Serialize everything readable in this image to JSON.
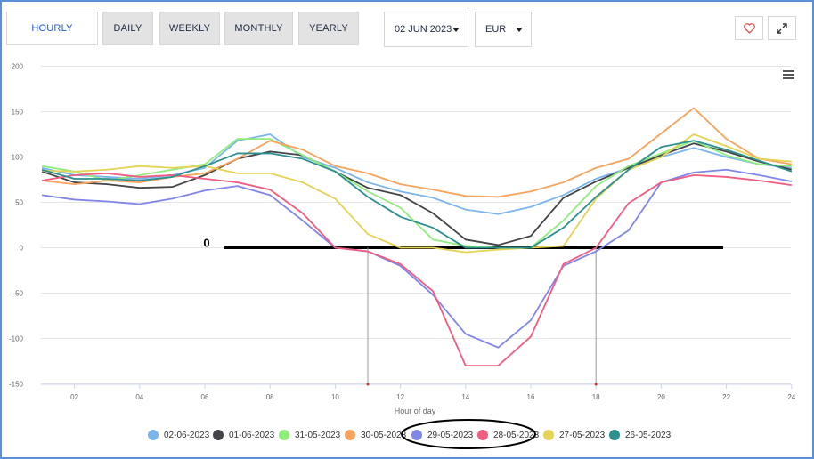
{
  "tabs": [
    {
      "label": "HOURLY",
      "active": true
    },
    {
      "label": "DAILY",
      "active": false
    },
    {
      "label": "WEEKLY",
      "active": false
    },
    {
      "label": "MONTHLY",
      "active": false
    },
    {
      "label": "YEARLY",
      "active": false
    }
  ],
  "date_select": {
    "value": "02 JUN 2023"
  },
  "currency_select": {
    "value": "EUR"
  },
  "icons": {
    "favorite": "heart-icon",
    "expand": "expand-icon",
    "menu": "hamburger-menu-icon"
  },
  "annotation": {
    "zero_label": "0"
  },
  "chart_data": {
    "type": "line",
    "xlabel": "Hour of day",
    "ylabel": "",
    "xlim": [
      0.5,
      24.2
    ],
    "ylim": [
      -150,
      200
    ],
    "y_ticks": [
      200,
      150,
      100,
      50,
      0,
      -50,
      -100,
      -150
    ],
    "x_ticks": [
      "02",
      "04",
      "06",
      "08",
      "10",
      "12",
      "14",
      "16",
      "18",
      "20",
      "22",
      "24"
    ],
    "grid": true,
    "legend_position": "bottom",
    "x": [
      1,
      2,
      3,
      4,
      5,
      6,
      7,
      8,
      9,
      10,
      11,
      12,
      13,
      14,
      15,
      16,
      17,
      18,
      19,
      20,
      21,
      22,
      23,
      24
    ],
    "series": [
      {
        "name": "02-06-2023",
        "color": "#7cb5ec",
        "values": [
          88,
          80,
          78,
          76,
          80,
          88,
          118,
          125,
          100,
          88,
          72,
          62,
          55,
          42,
          37,
          45,
          58,
          76,
          88,
          100,
          110,
          100,
          92,
          88
        ]
      },
      {
        "name": "01-06-2023",
        "color": "#434348",
        "values": [
          84,
          72,
          70,
          66,
          67,
          80,
          98,
          106,
          102,
          84,
          66,
          58,
          38,
          9,
          3,
          13,
          55,
          73,
          88,
          102,
          115,
          106,
          95,
          86
        ]
      },
      {
        "name": "31-05-2023",
        "color": "#90ed7d",
        "values": [
          90,
          84,
          74,
          80,
          86,
          92,
          120,
          120,
          102,
          84,
          62,
          44,
          9,
          2,
          0,
          0,
          30,
          68,
          90,
          104,
          118,
          102,
          92,
          90
        ]
      },
      {
        "name": "30-05-2023",
        "color": "#f7a35c",
        "values": [
          74,
          70,
          74,
          72,
          78,
          82,
          98,
          118,
          108,
          90,
          82,
          70,
          64,
          57,
          56,
          62,
          72,
          88,
          98,
          126,
          154,
          120,
          98,
          92
        ]
      },
      {
        "name": "29-05-2023",
        "color": "#8085e9",
        "values": [
          58,
          53,
          51,
          48,
          54,
          63,
          68,
          58,
          30,
          0,
          -4,
          -20,
          -52,
          -95,
          -110,
          -80,
          -20,
          -4,
          19,
          72,
          83,
          86,
          80,
          73
        ]
      },
      {
        "name": "28-05-2023",
        "color": "#f15c80",
        "values": [
          74,
          80,
          82,
          78,
          80,
          76,
          72,
          64,
          38,
          0,
          -4,
          -18,
          -48,
          -130,
          -130,
          -98,
          -18,
          0,
          49,
          72,
          80,
          78,
          74,
          69
        ]
      },
      {
        "name": "27-05-2023",
        "color": "#e4d354",
        "values": [
          85,
          84,
          86,
          90,
          88,
          90,
          82,
          82,
          72,
          54,
          15,
          0,
          0,
          -5,
          -2,
          0,
          2,
          54,
          86,
          100,
          125,
          112,
          98,
          95
        ]
      },
      {
        "name": "26-05-2023",
        "color": "#2b908f",
        "values": [
          86,
          76,
          76,
          74,
          78,
          90,
          104,
          104,
          98,
          84,
          56,
          34,
          22,
          0,
          0,
          0,
          22,
          56,
          86,
          111,
          118,
          108,
          96,
          84
        ]
      }
    ]
  }
}
